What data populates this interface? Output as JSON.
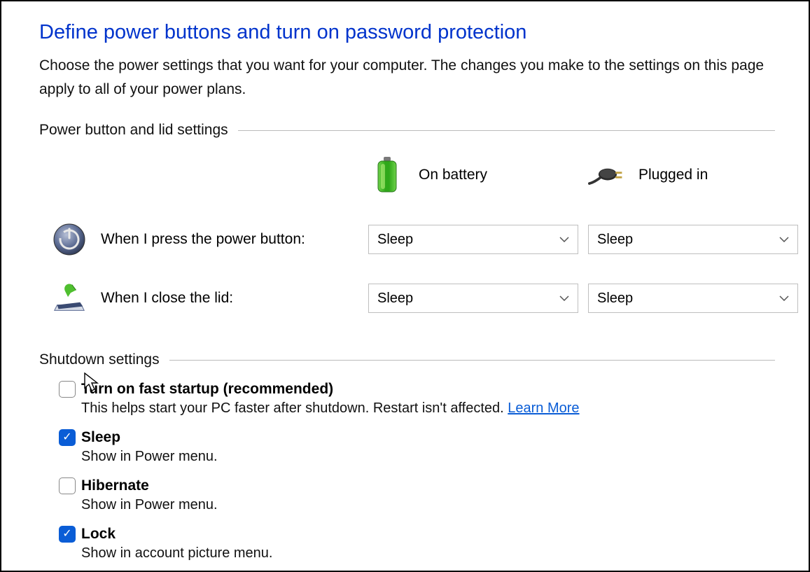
{
  "title": "Define power buttons and turn on password protection",
  "description": "Choose the power settings that you want for your computer. The changes you make to the settings on this page apply to all of your power plans.",
  "sections": {
    "power_button": {
      "header": "Power button and lid settings",
      "columns": {
        "battery": "On battery",
        "plugged": "Plugged in"
      },
      "rows": {
        "power_button": {
          "label": "When I press the power button:",
          "battery_value": "Sleep",
          "plugged_value": "Sleep"
        },
        "close_lid": {
          "label": "When I close the lid:",
          "battery_value": "Sleep",
          "plugged_value": "Sleep"
        }
      }
    },
    "shutdown": {
      "header": "Shutdown settings",
      "items": {
        "fast_startup": {
          "title": "Turn on fast startup (recommended)",
          "desc": "This helps start your PC faster after shutdown. Restart isn't affected. ",
          "link": "Learn More",
          "checked": false
        },
        "sleep": {
          "title": "Sleep",
          "desc": "Show in Power menu.",
          "checked": true
        },
        "hibernate": {
          "title": "Hibernate",
          "desc": "Show in Power menu.",
          "checked": false
        },
        "lock": {
          "title": "Lock",
          "desc": "Show in account picture menu.",
          "checked": true
        }
      }
    }
  }
}
